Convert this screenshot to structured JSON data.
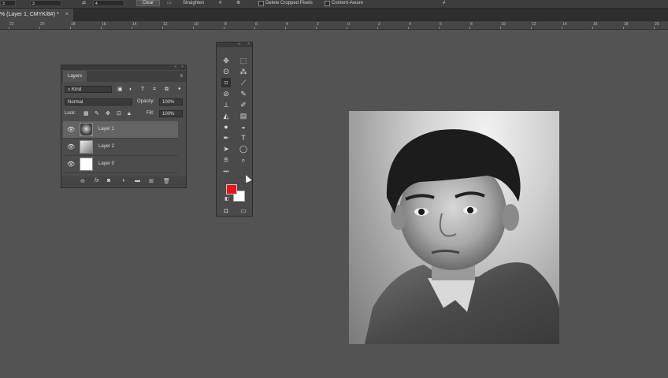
{
  "options_bar": {
    "field1": "3",
    "field2": "4",
    "clear_label": "Clear",
    "straighten_label": "Straighten",
    "delete_cropped_label": "Delete Cropped Pixels",
    "content_aware_label": "Content-Aware"
  },
  "tab": {
    "title": "% (Layer 1, CMYK/8#) *",
    "close": "×"
  },
  "ruler": {
    "marks": [
      "22",
      "20",
      "18",
      "16",
      "14",
      "12",
      "10",
      "8",
      "6",
      "4",
      "2",
      "0",
      "2",
      "4",
      "6",
      "8",
      "10",
      "12",
      "14",
      "16",
      "18",
      "20",
      "22"
    ]
  },
  "layers_panel": {
    "tab_label": "Layers",
    "filter_label": "Kind",
    "blend_mode": "Normal",
    "opacity_label": "Opacity:",
    "opacity_value": "100%",
    "lock_label": "Lock:",
    "fill_label": "Fill:",
    "fill_value": "100%",
    "layers": [
      {
        "name": "Layer 1",
        "selected": true,
        "visible": true,
        "thumb": "photo"
      },
      {
        "name": "Layer 2",
        "selected": false,
        "visible": true,
        "thumb": "gradient"
      },
      {
        "name": "Layer 0",
        "selected": false,
        "visible": true,
        "thumb": "white"
      }
    ]
  },
  "toolbar": {
    "foreground_color": "#e8141c",
    "background_color": "#ffffff",
    "more_tools": "•••"
  }
}
